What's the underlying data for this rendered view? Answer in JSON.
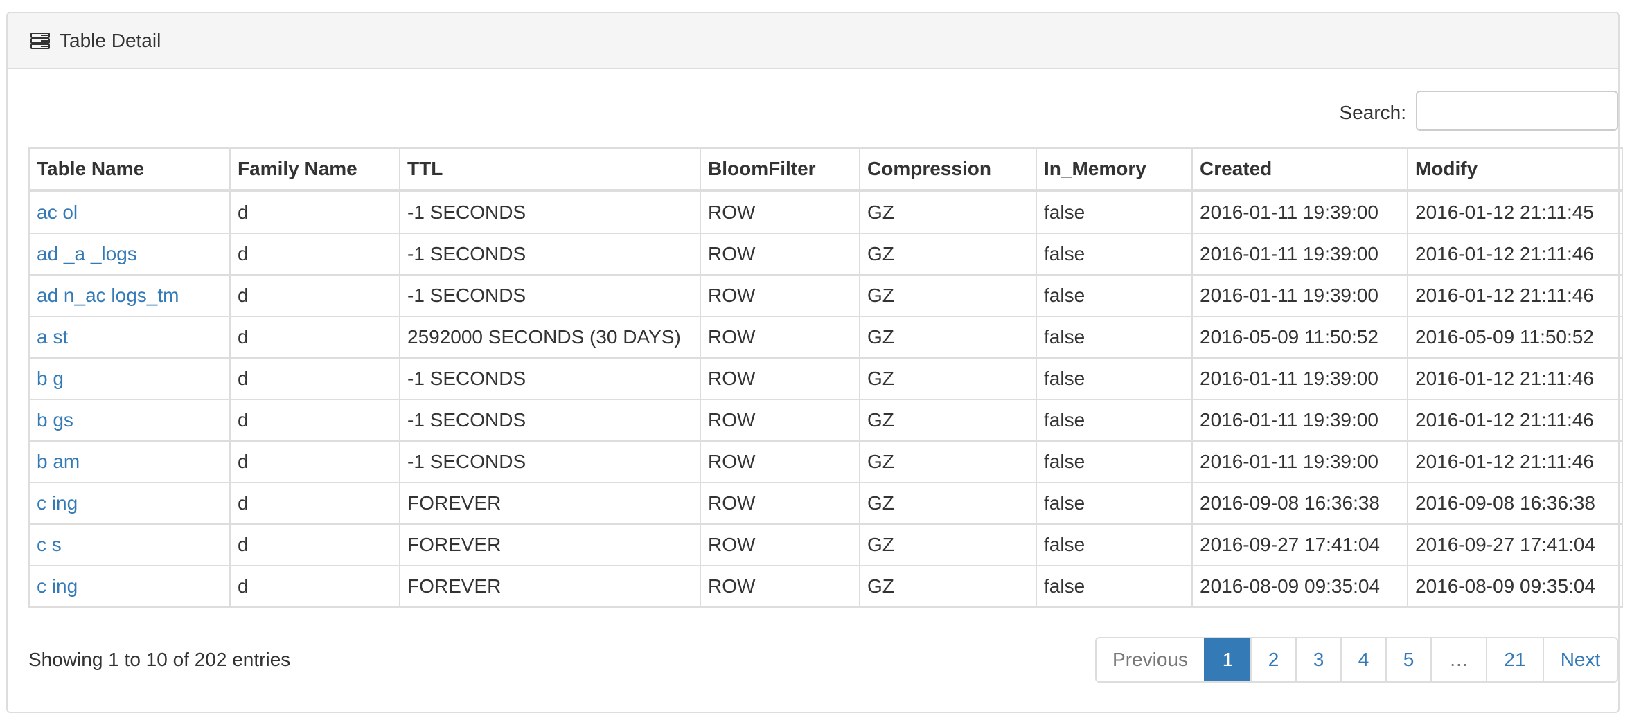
{
  "panel": {
    "title": "Table Detail",
    "icon": "table-list-icon"
  },
  "search": {
    "label": "Search:",
    "value": "",
    "placeholder": ""
  },
  "table": {
    "columns": [
      "Table Name",
      "Family Name",
      "TTL",
      "BloomFilter",
      "Compression",
      "In_Memory",
      "Created",
      "Modify"
    ],
    "rows": [
      [
        "ac  ol",
        "d",
        "-1 SECONDS",
        "ROW",
        "GZ",
        "false",
        "2016-01-11 19:39:00",
        "2016-01-12 21:11:45"
      ],
      [
        "ad  _a  _logs",
        "d",
        "-1 SECONDS",
        "ROW",
        "GZ",
        "false",
        "2016-01-11 19:39:00",
        "2016-01-12 21:11:46"
      ],
      [
        "ad  n_ac  logs_tm",
        "d",
        "-1 SECONDS",
        "ROW",
        "GZ",
        "false",
        "2016-01-11 19:39:00",
        "2016-01-12 21:11:46"
      ],
      [
        "a  st",
        "d",
        "2592000 SECONDS (30 DAYS)",
        "ROW",
        "GZ",
        "false",
        "2016-05-09 11:50:52",
        "2016-05-09 11:50:52"
      ],
      [
        "b  g",
        "d",
        "-1 SECONDS",
        "ROW",
        "GZ",
        "false",
        "2016-01-11 19:39:00",
        "2016-01-12 21:11:46"
      ],
      [
        "b  gs",
        "d",
        "-1 SECONDS",
        "ROW",
        "GZ",
        "false",
        "2016-01-11 19:39:00",
        "2016-01-12 21:11:46"
      ],
      [
        "b  am",
        "d",
        "-1 SECONDS",
        "ROW",
        "GZ",
        "false",
        "2016-01-11 19:39:00",
        "2016-01-12 21:11:46"
      ],
      [
        "c  ing",
        "d",
        "FOREVER",
        "ROW",
        "GZ",
        "false",
        "2016-09-08 16:36:38",
        "2016-09-08 16:36:38"
      ],
      [
        "c  s",
        "d",
        "FOREVER",
        "ROW",
        "GZ",
        "false",
        "2016-09-27 17:41:04",
        "2016-09-27 17:41:04"
      ],
      [
        "c  ing",
        "d",
        "FOREVER",
        "ROW",
        "GZ",
        "false",
        "2016-08-09 09:35:04",
        "2016-08-09 09:35:04"
      ]
    ]
  },
  "footer": {
    "info": "Showing 1 to 10 of 202 entries"
  },
  "pagination": {
    "previous": "Previous",
    "pages": [
      "1",
      "2",
      "3",
      "4",
      "5"
    ],
    "ellipsis": "…",
    "last": "21",
    "next": "Next",
    "active": "1"
  },
  "colors": {
    "link": "#337ab7",
    "active_page": "#337ab7",
    "border": "#dddddd",
    "heading_bg": "#f5f5f5"
  }
}
